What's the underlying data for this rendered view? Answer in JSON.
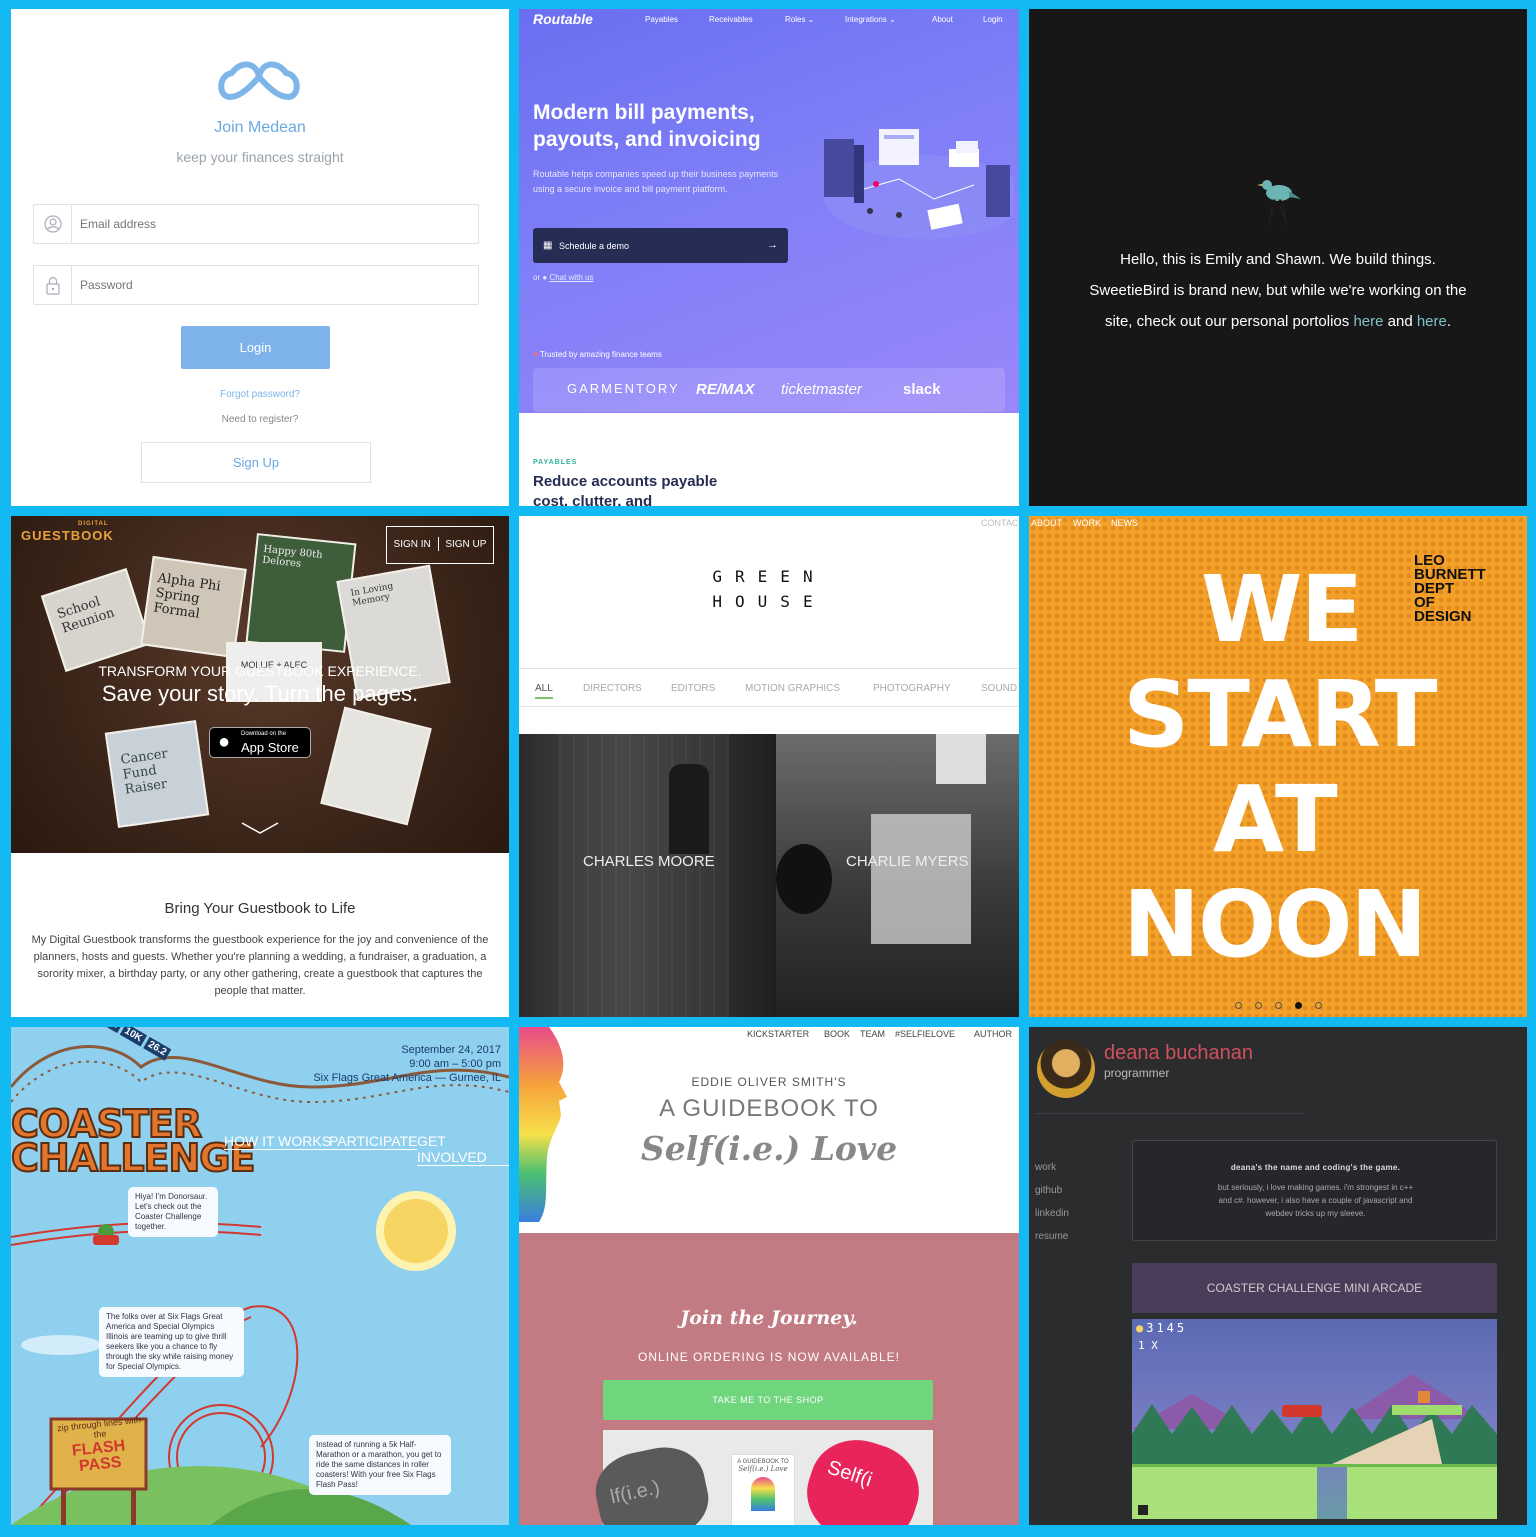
{
  "medean": {
    "title": "Join Medean",
    "subtitle": "keep your finances straight",
    "email_placeholder": "Email address",
    "password_placeholder": "Password",
    "login_label": "Login",
    "forgot_label": "Forgot password?",
    "register_label": "Need to register?",
    "signup_label": "Sign Up"
  },
  "routable": {
    "logo": "Routable",
    "nav": [
      "Payables",
      "Receivables",
      "Roles ⌄",
      "Integrations ⌄",
      "About",
      "Login"
    ],
    "headline": "Modern bill payments, payouts, and invoicing",
    "description": "Routable helps companies speed up their business payments using a secure invoice and bill payment platform.",
    "cta_label": "Schedule a demo",
    "or_label": "or",
    "chat_label": "Chat with us",
    "trusted_label": "Trusted by amazing finance teams",
    "brands": [
      "GARMENTORY",
      "RE/MAX",
      "ticketmaster",
      "slack"
    ],
    "section_label": "PAYABLES",
    "section_title": "Reduce accounts payable",
    "section_title_cut": "cost, clutter, and"
  },
  "sweetiebird": {
    "line1": "Hello, this is Emily and Shawn. We build things.",
    "line2": "SweetieBird is brand new, but while we're working on the",
    "line3_pre": "site, check out our personal portolios",
    "link1": "here",
    "and": "and",
    "link2": "here",
    "period": "."
  },
  "guestbook": {
    "logo_small": "DIGITAL",
    "logo": "GUESTBOOK",
    "auth_signin": "SIGN IN",
    "auth_signup": "SIGN UP",
    "kicker": "TRANSFORM YOUR GUESTBOOK EXPERIENCE.",
    "headline": "Save your story. Turn the pages.",
    "appstore_small": "Download on the",
    "appstore": "App Store",
    "section_title": "Bring Your Guestbook to Life",
    "section_body": "My Digital Guestbook transforms the guestbook experience for the joy and convenience of the planners, hosts and guests. Whether you're planning a wedding, a fundraiser, a graduation, a sorority mixer, a birthday party, or any other gathering, create a guestbook that captures the people that matter.",
    "cards": [
      "School Reunion",
      "Alpha Phi Spring Formal",
      "Happy 80th Delores",
      "In Loving Memory",
      "MOLLIE + ALEC",
      "Cancer Fund Raiser"
    ]
  },
  "greenhouse": {
    "contact": "CONTAC",
    "logo_line1": "GREEN",
    "logo_line2": "HOUSE",
    "tabs": [
      "ALL",
      "DIRECTORS",
      "EDITORS",
      "MOTION GRAPHICS",
      "PHOTOGRAPHY",
      "SOUND"
    ],
    "people": [
      "CHARLES MOORE",
      "CHARLIE MYERS"
    ]
  },
  "leoburnett": {
    "nav": [
      "ABOUT",
      "WORK",
      "NEWS"
    ],
    "words": [
      "WE",
      "START",
      "AT",
      "NOON"
    ],
    "dept": [
      "LEO",
      "BURNETT",
      "DEPT",
      "OF",
      "DESIGN"
    ]
  },
  "coaster": {
    "title_line1": "COASTER",
    "title_line2": "CHALLENGE",
    "distances": [
      "5K",
      "10K",
      "26.2"
    ],
    "date": "September 24, 2017",
    "time": "9:00 am – 5:00 pm",
    "place": "Six Flags Great America — Gurnee, IL",
    "nav": [
      "HOW IT WORKS",
      "PARTICIPATE",
      "GET INVOLVED"
    ],
    "bubble1": "Hiya! I'm Donorsaur. Let's check out the Coaster Challenge together.",
    "bubble2": "The folks over at Six Flags Great America and Special Olympics Illinois are teaming up to give thrill seekers like you a chance to fly through the sky while raising money for Special Olympics.",
    "bubble3": "Instead of running a 5k Half-Marathon or a marathon, you get to ride the same distances in roller coasters! With your free Six Flags Flash Pass!",
    "sign_top": "zip through lines with the",
    "sign_main": "FLASH PASS"
  },
  "selflove": {
    "nav": [
      "KICKSTARTER",
      "BOOK",
      "TEAM",
      "#SELFIELOVE",
      "AUTHOR"
    ],
    "byline": "EDDIE OLIVER SMITH'S",
    "title": "A GUIDEBOOK TO",
    "title_script": "Self(i.e.) Love",
    "join": "Join the Journey.",
    "ordering": "ONLINE ORDERING IS NOW AVAILABLE!",
    "shop_label": "TAKE ME TO THE SHOP",
    "book_small": "A GUIDEBOOK TO",
    "book_script": "Self(i.e.) Love",
    "pillow1": "lf(i.e.)",
    "pillow2": "Self(i"
  },
  "deana": {
    "name": "deana buchanan",
    "role": "programmer",
    "links": [
      "work",
      "github",
      "linkedin",
      "resume"
    ],
    "tagline": "deana's the name and coding's the game.",
    "bio": "but seriously, i love making games. i'm strongest in c++ and c#. however, i also have a couple of javascript and webdev tricks up my sleeve.",
    "arcade": "COASTER CHALLENGE MINI ARCADE",
    "score": "3145",
    "lives": "1 X"
  }
}
